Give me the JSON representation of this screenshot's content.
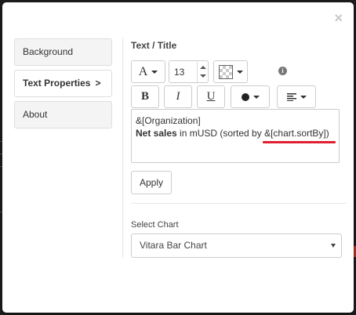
{
  "close_glyph": "×",
  "nav": {
    "items": [
      {
        "label": "Background"
      },
      {
        "label": "Text Properties",
        "arrow": ">"
      },
      {
        "label": "About"
      }
    ]
  },
  "panel": {
    "title": "Text / Title",
    "font_size": "13",
    "info_glyph": "i",
    "bold_label": "B",
    "italic_label": "I",
    "underline_label": "U",
    "font_icon_label": "A",
    "text": {
      "line1": "&[Organization]",
      "line2_bold": "Net sales",
      "line2_rest": " in mUSD (sorted by ",
      "line2_token": "&[chart.sortBy]",
      "line2_end": ")"
    },
    "apply_label": "Apply",
    "select_label": "Select Chart",
    "select_value": "Vitara Bar Chart"
  }
}
